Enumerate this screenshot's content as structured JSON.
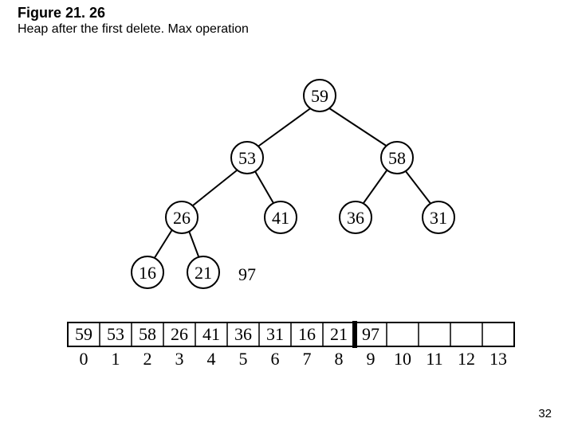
{
  "figure_label": "Figure 21. 26",
  "caption": "Heap after the first delete. Max operation",
  "page_number": "32",
  "chart_data": {
    "type": "table",
    "title": "Max-heap tree and array representation",
    "tree": {
      "nodes": [
        {
          "id": 0,
          "value": 59,
          "parent": null
        },
        {
          "id": 1,
          "value": 53,
          "parent": 0
        },
        {
          "id": 2,
          "value": 58,
          "parent": 0
        },
        {
          "id": 3,
          "value": 26,
          "parent": 1
        },
        {
          "id": 4,
          "value": 41,
          "parent": 1
        },
        {
          "id": 5,
          "value": 36,
          "parent": 2
        },
        {
          "id": 6,
          "value": 31,
          "parent": 2
        },
        {
          "id": 7,
          "value": 16,
          "parent": 3
        },
        {
          "id": 8,
          "value": 21,
          "parent": 3
        }
      ],
      "extra_label": {
        "value": 97,
        "near_node": 8
      }
    },
    "array": {
      "indices": [
        0,
        1,
        2,
        3,
        4,
        5,
        6,
        7,
        8,
        9,
        10,
        11,
        12,
        13
      ],
      "values": [
        "59",
        "53",
        "58",
        "26",
        "41",
        "36",
        "31",
        "16",
        "21",
        "97",
        "",
        "",
        "",
        ""
      ],
      "divider_after_index": 8
    }
  },
  "nodes": {
    "n0": "59",
    "n1": "53",
    "n2": "58",
    "n3": "26",
    "n4": "41",
    "n5": "36",
    "n6": "31",
    "n7": "16",
    "n8": "21",
    "extra": "97"
  },
  "arr": {
    "v0": "59",
    "v1": "53",
    "v2": "58",
    "v3": "26",
    "v4": "41",
    "v5": "36",
    "v6": "31",
    "v7": "16",
    "v8": "21",
    "v9": "97",
    "v10": "",
    "v11": "",
    "v12": "",
    "v13": "",
    "i0": "0",
    "i1": "1",
    "i2": "2",
    "i3": "3",
    "i4": "4",
    "i5": "5",
    "i6": "6",
    "i7": "7",
    "i8": "8",
    "i9": "9",
    "i10": "10",
    "i11": "11",
    "i12": "12",
    "i13": "13"
  }
}
